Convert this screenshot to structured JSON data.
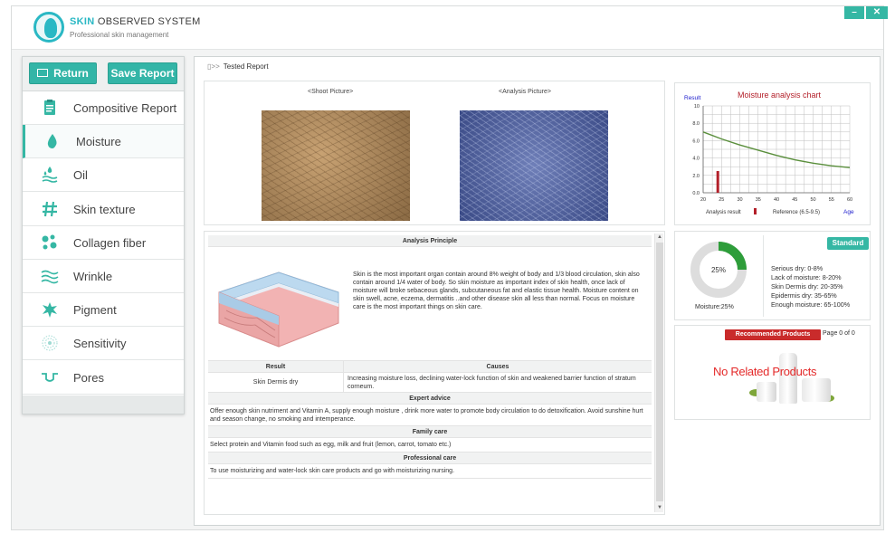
{
  "app": {
    "title_brand": "SKIN",
    "title_rest": " OBSERVED SYSTEM",
    "subtitle": "Professional skin management"
  },
  "window_controls": {
    "minimize": "–",
    "close": "✕"
  },
  "toolbar": {
    "return_label": "Return",
    "save_label": "Save Report"
  },
  "sidebar": {
    "items": [
      {
        "label": "Compositive Report",
        "icon": "report-icon"
      },
      {
        "label": "Moisture",
        "icon": "water-drop-icon"
      },
      {
        "label": "Oil",
        "icon": "oil-drops-icon"
      },
      {
        "label": "Skin texture",
        "icon": "hash-grid-icon"
      },
      {
        "label": "Collagen fiber",
        "icon": "collagen-dots-icon"
      },
      {
        "label": "Wrinkle",
        "icon": "wave-lines-icon"
      },
      {
        "label": "Pigment",
        "icon": "pigment-splat-icon"
      },
      {
        "label": "Sensitivity",
        "icon": "sensitivity-icon"
      },
      {
        "label": "Pores",
        "icon": "pore-icon"
      }
    ],
    "active_index": 1
  },
  "breadcrumb": {
    "arrows": "▯>>",
    "label": "Tested Report"
  },
  "pictures": {
    "shoot_label": "<Shoot Picture>",
    "analysis_label": "<Analysis Picture>"
  },
  "chart_data": {
    "type": "line",
    "title": "Moisture analysis chart",
    "ylabel": "Result",
    "xlabel": "Age",
    "x_ticks": [
      "20",
      "25",
      "30",
      "35",
      "40",
      "45",
      "50",
      "55",
      "60"
    ],
    "y_ticks": [
      "0.0",
      "2.0",
      "4.0",
      "6.0",
      "8.0",
      "10"
    ],
    "xlim": [
      20,
      60
    ],
    "ylim": [
      0,
      10
    ],
    "series": [
      {
        "name": "Reference (6.5-9.5)",
        "type": "line",
        "x": [
          20,
          25,
          30,
          35,
          40,
          45,
          50,
          55,
          60
        ],
        "values": [
          7.0,
          6.2,
          5.5,
          4.9,
          4.3,
          3.8,
          3.4,
          3.1,
          2.9
        ]
      },
      {
        "name": "Analysis result",
        "type": "bar",
        "x": [
          24
        ],
        "values": [
          2.5
        ]
      }
    ],
    "legend": [
      "Analysis result",
      "Reference (6.5-9.5)"
    ],
    "colors": {
      "reference": "#5a8f3c",
      "result": "#b3202a",
      "title": "#b3202a",
      "axis_label": "#1a1acc",
      "grid": "#bfbfbf"
    }
  },
  "moisture": {
    "gauge_value": "25%",
    "gauge_fraction": 0.25,
    "caption": "Moisture:25%"
  },
  "standard": {
    "badge": "Standard",
    "lines": [
      "Serious dry: 0-8%",
      "Lack of moisture: 8-20%",
      "Skin Dermis dry: 20-35%",
      "Epidermis dry: 35-65%",
      "Enough moisture: 65-100%"
    ]
  },
  "products": {
    "badge": "Recommended Products",
    "page_info": "Page 0 of 0",
    "empty_text": "No Related Products"
  },
  "analysis": {
    "principle_title": "Analysis Principle",
    "principle_text": "Skin is the most important organ contain around 8% weight of body and 1/3 blood circulation, skin also contain around 1/4 water of body. So skin moisture as important index of skin health, once lack of moisture will broke sebaceous glands, subcutaneous fat and elastic tissue health. Moisture content on skin swell, acne, eczema, dermatitis ..and other disease skin all less than normal. Focus on moisture care is the most important things on skin care.",
    "result_header": "Result",
    "causes_header": "Causes",
    "result_value": "Skin Dermis dry",
    "causes_value": "Increasing moisture loss, declining water-lock function of skin and weakened barrier function of stratum corneum.",
    "expert_title": "Expert advice",
    "expert_text": "Offer enough skin nutriment and Vitamin A, supply enough moisture , drink more water to promote body circulation to do detoxification. Avoid sunshine hurt and season change, no smoking and intemperance.",
    "family_title": "Family care",
    "family_text": "Select protein and Vitamin food such as egg, milk and fruit (lemon, carrot, tomato etc.)",
    "professional_title": "Professional care",
    "professional_text": "To use moisturizing and water-lock skin care products and go with moisturizing nursing."
  }
}
